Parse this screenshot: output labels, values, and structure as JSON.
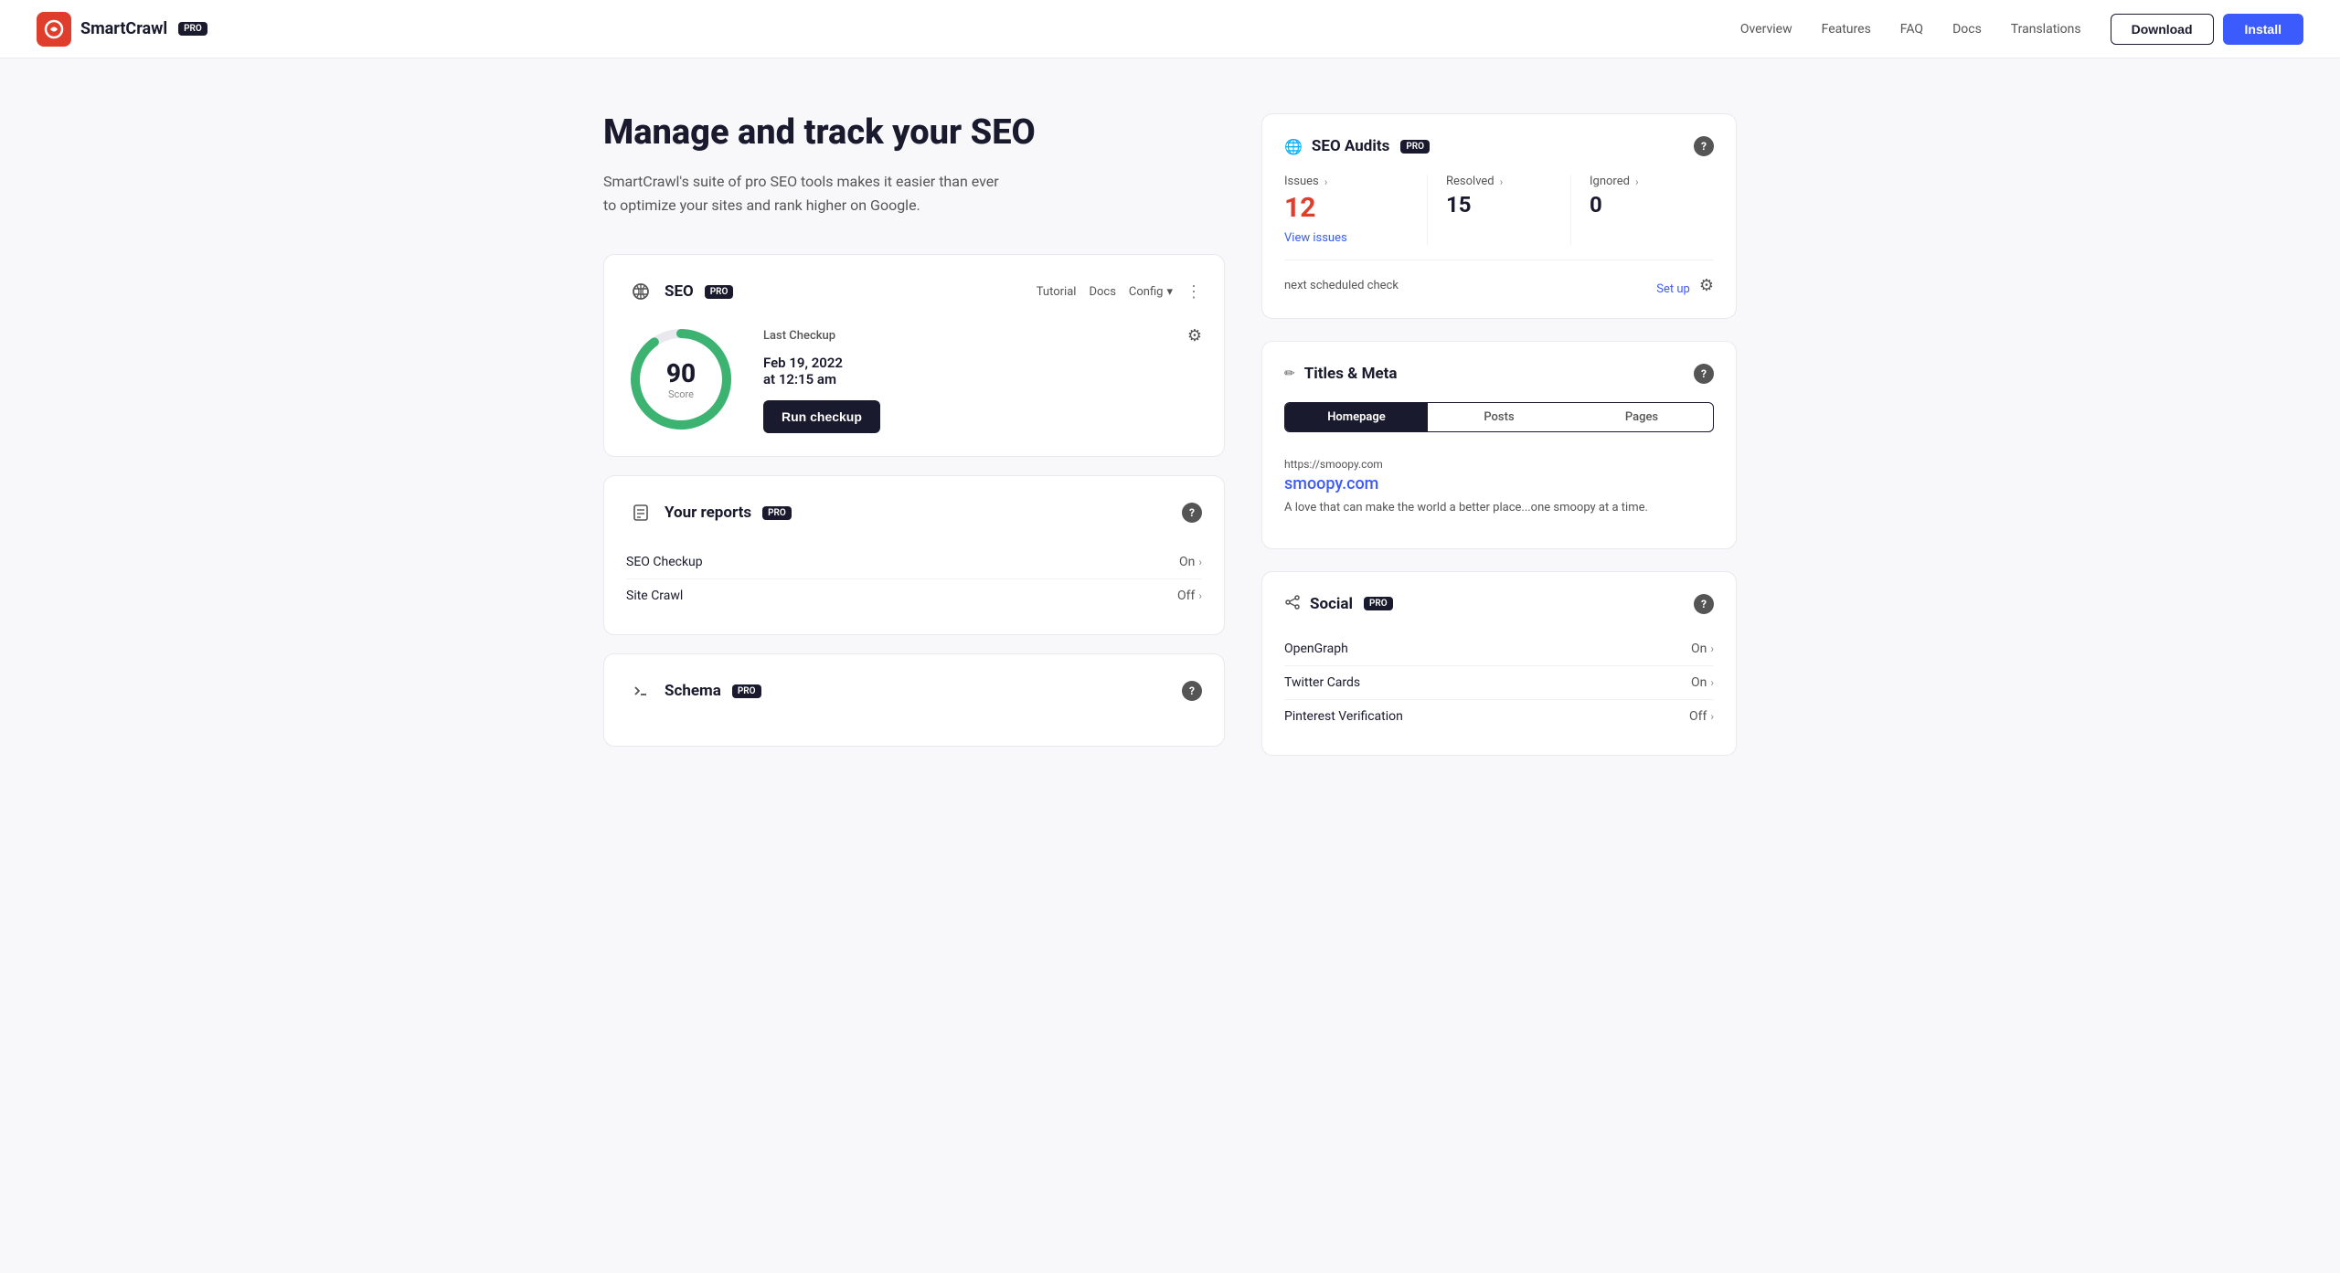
{
  "navbar": {
    "logo_text": "SmartCrawl",
    "pro_label": "PRO",
    "nav_links": [
      "Overview",
      "Features",
      "FAQ",
      "Docs",
      "Translations"
    ],
    "download_btn": "Download",
    "install_btn": "Install"
  },
  "hero": {
    "title": "Manage and track your SEO",
    "description": "SmartCrawl's suite of pro SEO tools makes it easier than ever to optimize your sites and rank higher on Google."
  },
  "seo_card": {
    "title": "SEO",
    "pro_label": "PRO",
    "tutorial_link": "Tutorial",
    "docs_link": "Docs",
    "config_link": "Config",
    "score": 90,
    "score_label": "Score",
    "last_checkup_label": "Last Checkup",
    "checkup_date": "Feb 19, 2022",
    "checkup_time": "at 12:15 am",
    "run_checkup_btn": "Run checkup"
  },
  "reports_card": {
    "title": "Your reports",
    "pro_label": "PRO",
    "rows": [
      {
        "label": "SEO Checkup",
        "status": "On"
      },
      {
        "label": "Site Crawl",
        "status": "Off"
      }
    ]
  },
  "schema_card": {
    "title": "Schema",
    "pro_label": "PRO"
  },
  "seo_audits": {
    "title": "SEO Audits",
    "pro_label": "PRO",
    "issues_label": "Issues",
    "issues_value": "12",
    "resolved_label": "Resolved",
    "resolved_value": "15",
    "ignored_label": "Ignored",
    "ignored_value": "0",
    "view_issues_link": "View issues",
    "schedule_label": "next scheduled check",
    "setup_link": "Set up"
  },
  "titles_meta": {
    "title": "Titles & Meta",
    "tabs": [
      "Homepage",
      "Posts",
      "Pages"
    ],
    "active_tab": "Homepage",
    "url": "https://smoopy.com",
    "site_name": "smoopy.com",
    "description": "A love that can make the world a better place...one smoopy at a time."
  },
  "social": {
    "title": "Social",
    "pro_label": "PRO",
    "rows": [
      {
        "label": "OpenGraph",
        "status": "On"
      },
      {
        "label": "Twitter Cards",
        "status": "On"
      },
      {
        "label": "Pinterest Verification",
        "status": "Off"
      }
    ]
  }
}
